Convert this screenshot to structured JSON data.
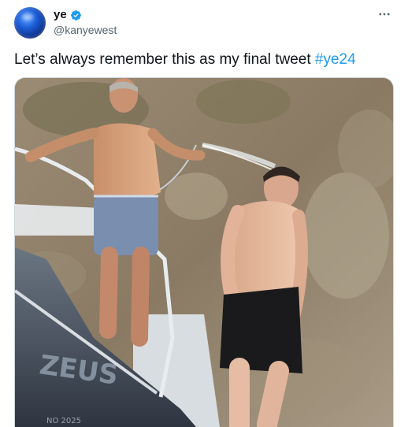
{
  "author": {
    "display_name": "ye",
    "handle": "@kanyewest",
    "verified": true,
    "avatar_icon": "blue-sphere-avatar"
  },
  "tweet": {
    "text_before": "Let’s always remember this as my final tweet ",
    "hashtag": "#ye24"
  },
  "media": {
    "boat_lettering": "ZEUS",
    "hull_code": "NO 2025"
  },
  "colors": {
    "accent": "#1d9bf0",
    "text": "#0f1419",
    "secondary": "#536471"
  },
  "icons": [
    "verified-badge-icon",
    "more-options-icon"
  ]
}
